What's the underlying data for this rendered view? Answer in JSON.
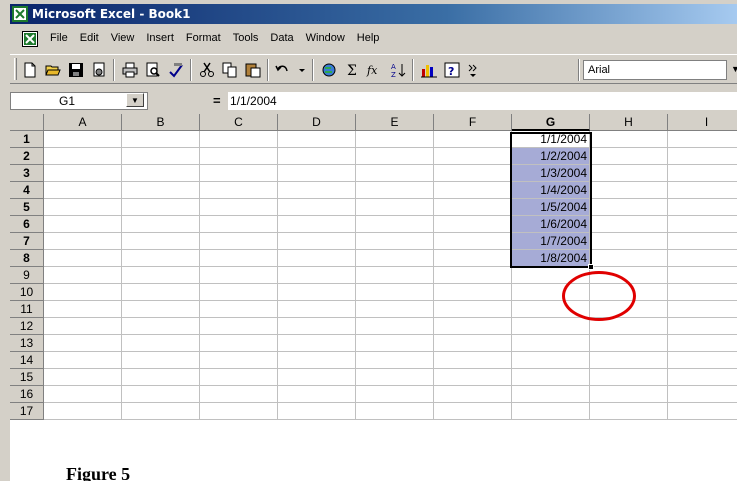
{
  "window": {
    "title": "Microsoft Excel - Book1"
  },
  "menu": {
    "items": [
      "File",
      "Edit",
      "View",
      "Insert",
      "Format",
      "Tools",
      "Data",
      "Window",
      "Help"
    ]
  },
  "toolbar": {
    "buttons": [
      "new-icon",
      "open-icon",
      "save-icon",
      "permission-icon",
      "print-icon",
      "print-preview-icon",
      "spelling-icon",
      "cut-icon",
      "copy-icon",
      "paste-icon",
      "undo-icon",
      "hyperlink-icon",
      "autosum-icon",
      "function-icon",
      "sort-ascending-icon",
      "chart-wizard-icon",
      "help-icon",
      "more-buttons-icon"
    ],
    "font_name": "Arial"
  },
  "formula_bar": {
    "name_box": "G1",
    "equals": "=",
    "value": "1/1/2004"
  },
  "grid": {
    "columns": [
      "A",
      "B",
      "C",
      "D",
      "E",
      "F",
      "G",
      "H",
      "I"
    ],
    "rows": [
      "1",
      "2",
      "3",
      "4",
      "5",
      "6",
      "7",
      "8",
      "9",
      "10",
      "11",
      "12",
      "13",
      "14",
      "15",
      "16",
      "17"
    ],
    "column_g_values": [
      "1/1/2004",
      "1/2/2004",
      "1/3/2004",
      "1/4/2004",
      "1/5/2004",
      "1/6/2004",
      "1/7/2004",
      "1/8/2004"
    ],
    "selected_range": "G1:G8",
    "active_cell": "G1"
  },
  "annotation": {
    "circle_color": "#e00000"
  },
  "caption": {
    "text": "Figure 5"
  }
}
